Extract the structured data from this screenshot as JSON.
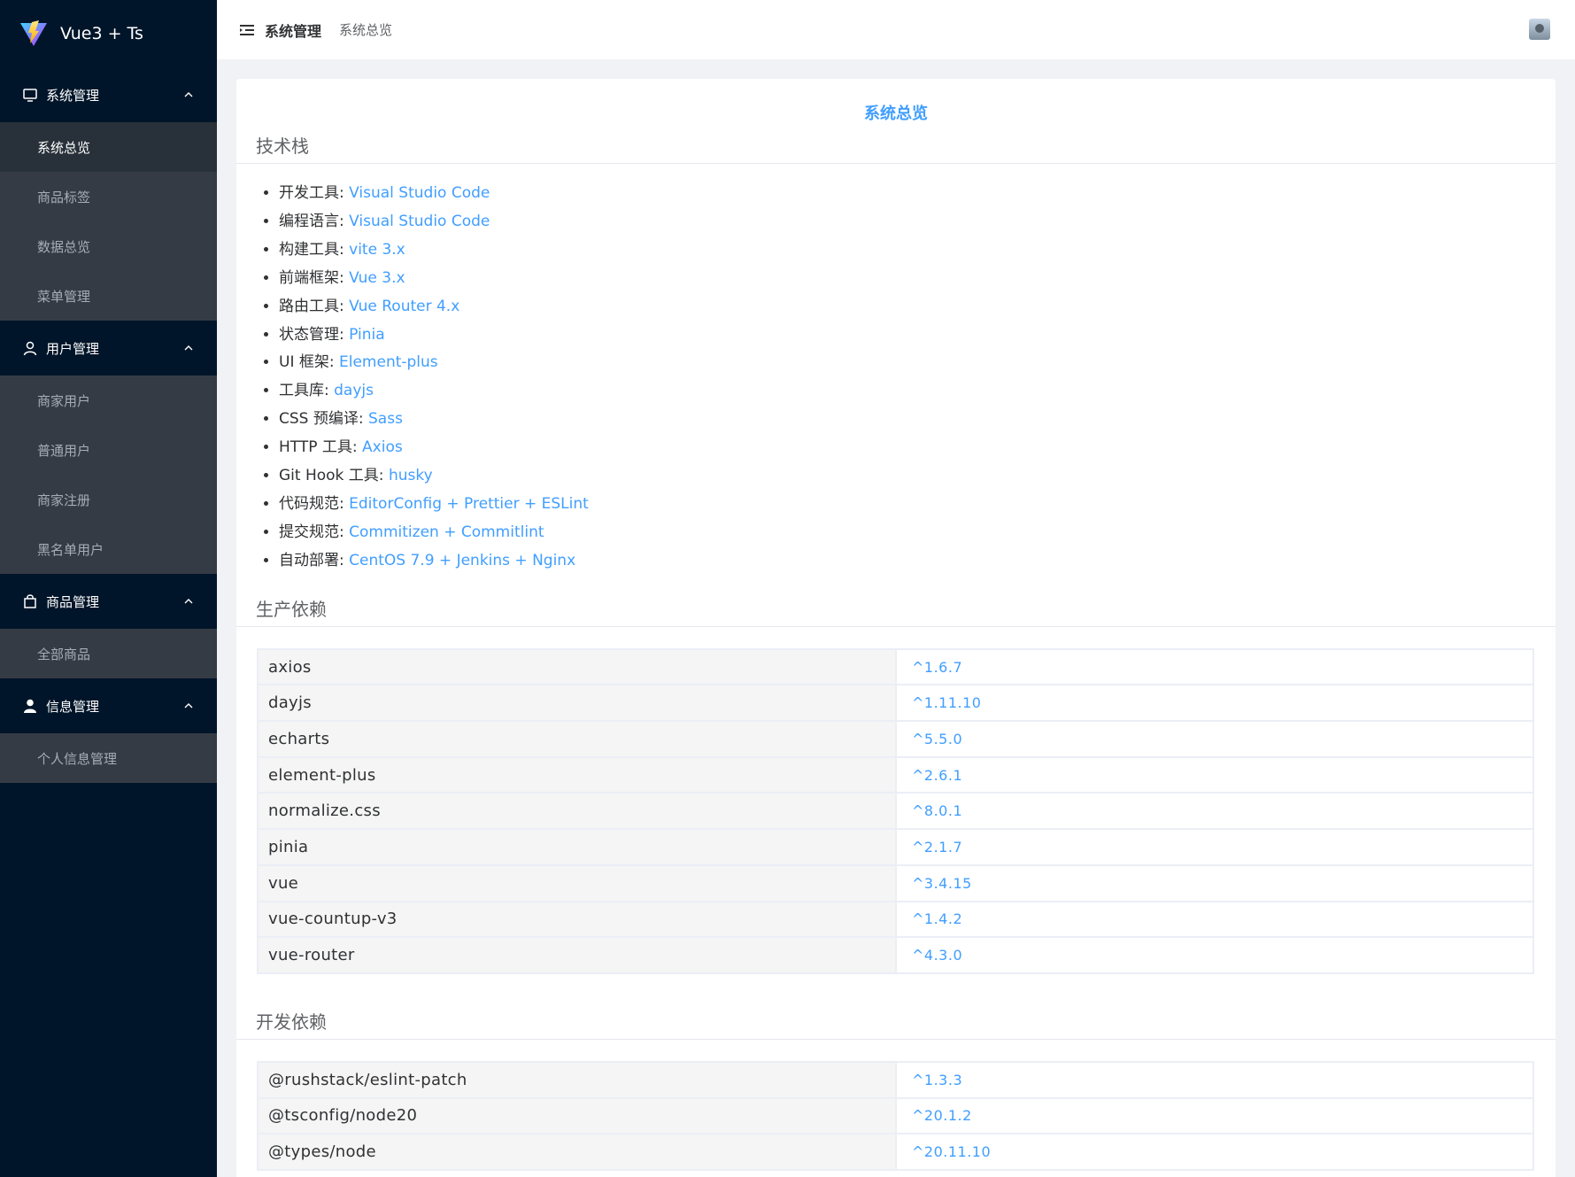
{
  "app": {
    "logo_text": "Vue3 + Ts"
  },
  "header": {
    "breadcrumb_main": "系统管理",
    "breadcrumb_sub": "系统总览"
  },
  "sidebar": {
    "groups": [
      {
        "title": "系统管理",
        "icon": "monitor-icon",
        "items": [
          {
            "label": "系统总览",
            "active": true
          },
          {
            "label": "商品标签"
          },
          {
            "label": "数据总览"
          },
          {
            "label": "菜单管理"
          }
        ]
      },
      {
        "title": "用户管理",
        "icon": "user-icon",
        "items": [
          {
            "label": "商家用户"
          },
          {
            "label": "普通用户"
          },
          {
            "label": "商家注册"
          },
          {
            "label": "黑名单用户"
          }
        ]
      },
      {
        "title": "商品管理",
        "icon": "shopping-bag-icon",
        "items": [
          {
            "label": "全部商品"
          }
        ]
      },
      {
        "title": "信息管理",
        "icon": "user-filled-icon",
        "items": [
          {
            "label": "个人信息管理"
          }
        ]
      }
    ]
  },
  "main": {
    "title": "系统总览",
    "tech_title": "技术栈",
    "tech_stack": [
      {
        "k": "开发工具: ",
        "v": "Visual Studio Code"
      },
      {
        "k": "编程语言: ",
        "v": "Visual Studio Code"
      },
      {
        "k": "构建工具: ",
        "v": "vite 3.x"
      },
      {
        "k": "前端框架: ",
        "v": "Vue 3.x"
      },
      {
        "k": "路由工具: ",
        "v": "Vue Router 4.x"
      },
      {
        "k": "状态管理: ",
        "v": "Pinia"
      },
      {
        "k": "UI 框架: ",
        "v": "Element-plus"
      },
      {
        "k": "工具库: ",
        "v": "dayjs"
      },
      {
        "k": "CSS 预编译: ",
        "v": "Sass"
      },
      {
        "k": "HTTP 工具: ",
        "v": "Axios"
      },
      {
        "k": "Git Hook 工具: ",
        "v": "husky"
      },
      {
        "k": "代码规范: ",
        "v": "EditorConfig + Prettier + ESLint"
      },
      {
        "k": "提交规范: ",
        "v": "Commitizen + Commitlint"
      },
      {
        "k": "自动部署: ",
        "v": "CentOS 7.9 + Jenkins + Nginx"
      }
    ],
    "prod_title": "生产依赖",
    "prod_deps": [
      {
        "name": "axios",
        "ver": "^1.6.7"
      },
      {
        "name": "dayjs",
        "ver": "^1.11.10"
      },
      {
        "name": "echarts",
        "ver": "^5.5.0"
      },
      {
        "name": "element-plus",
        "ver": "^2.6.1"
      },
      {
        "name": "normalize.css",
        "ver": "^8.0.1"
      },
      {
        "name": "pinia",
        "ver": "^2.1.7"
      },
      {
        "name": "vue",
        "ver": "^3.4.15"
      },
      {
        "name": "vue-countup-v3",
        "ver": "^1.4.2"
      },
      {
        "name": "vue-router",
        "ver": "^4.3.0"
      }
    ],
    "dev_title": "开发依赖",
    "dev_deps": [
      {
        "name": "@rushstack/eslint-patch",
        "ver": "^1.3.3"
      },
      {
        "name": "@tsconfig/node20",
        "ver": "^20.1.2"
      },
      {
        "name": "@types/node",
        "ver": "^20.11.10"
      }
    ]
  }
}
